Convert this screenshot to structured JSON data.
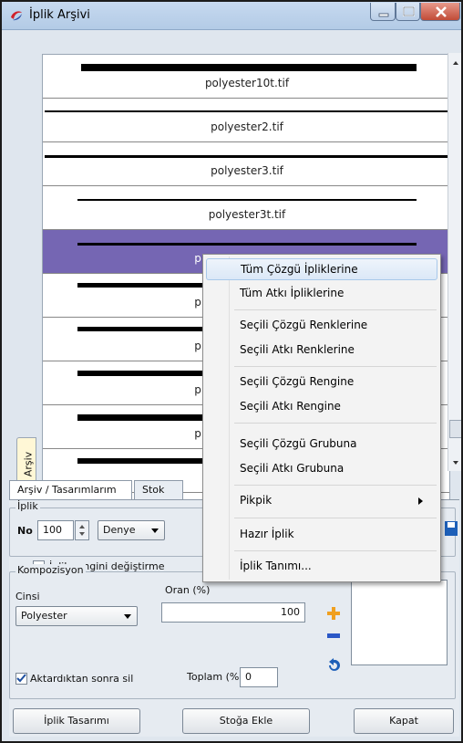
{
  "window": {
    "title": "İplik Arşivi"
  },
  "archive": {
    "side_tab": "Arşiv",
    "yarns": [
      {
        "name": "polyester10t.tif",
        "selected": false
      },
      {
        "name": "polyester2.tif",
        "selected": false
      },
      {
        "name": "polyester3.tif",
        "selected": false
      },
      {
        "name": "polyester3t.tif",
        "selected": false
      },
      {
        "name": "p",
        "selected": true
      },
      {
        "name": "p",
        "selected": false
      },
      {
        "name": "p",
        "selected": false
      },
      {
        "name": "p",
        "selected": false
      },
      {
        "name": "p",
        "selected": false
      }
    ]
  },
  "tabs": [
    "Arşiv / Tasarımlarım",
    "Stok"
  ],
  "iplik": {
    "legend": "İplik",
    "no_label": "No",
    "no_value": "100",
    "unit": "Denye",
    "change_color_label": "İplik rengini değiştirme"
  },
  "composition": {
    "legend": "Kompozisyon",
    "type_label": "Cinsi",
    "type_value": "Polyester",
    "ratio_label": "Oran (%)",
    "ratio_value": "100",
    "remove_after_label": "Aktardıktan sonra sil",
    "remove_after_checked": true,
    "total_label": "Toplam (%)",
    "total_value": "0"
  },
  "buttons": {
    "design": "İplik Tasarımı",
    "add_stock": "Stoğa Ekle",
    "close": "Kapat"
  },
  "context_menu": [
    "Tüm Çözgü İpliklerine",
    "Tüm Atkı İpliklerine",
    "Seçili Çözgü Renklerine",
    "Seçili Atkı Renklerine",
    "Seçili Çözgü Rengine",
    "Seçili Atkı Rengine",
    "Seçili Çözgü Grubuna",
    "Seçili Atkı Grubuna",
    "Pikpik",
    "Hazır İplik",
    "İplik Tanımı..."
  ],
  "colors": {
    "selection": "#7566b3",
    "accent": "#1d5fb8"
  }
}
